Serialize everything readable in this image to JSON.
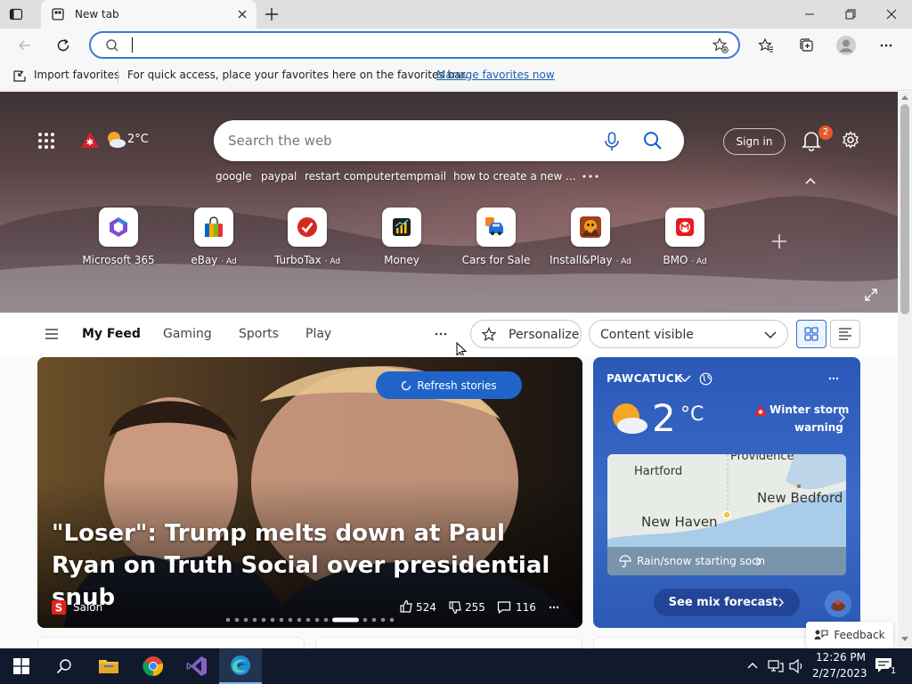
{
  "browser": {
    "tab_title": "New tab",
    "address_value": "",
    "favorites_bar": {
      "import_label": "Import favorites",
      "message": "For quick access, place your favorites here on the favorites bar.",
      "manage_link": "Manage favorites now"
    }
  },
  "hero": {
    "temperature": "2°C",
    "search_placeholder": "Search the web",
    "sign_in_label": "Sign in",
    "notification_count": "2",
    "trending": [
      "google",
      "paypal",
      "restart computer",
      "tempmail",
      "how to create a new ..."
    ],
    "quick_links": [
      {
        "label": "Microsoft 365",
        "ad": ""
      },
      {
        "label": "eBay",
        "ad": "· Ad"
      },
      {
        "label": "TurboTax",
        "ad": "· Ad"
      },
      {
        "label": "Money",
        "ad": ""
      },
      {
        "label": "Cars for Sale",
        "ad": ""
      },
      {
        "label": "Install&Play",
        "ad": "· Ad"
      },
      {
        "label": "BMO",
        "ad": "· Ad"
      }
    ]
  },
  "feed_nav": {
    "tabs": [
      "My Feed",
      "Gaming",
      "Sports",
      "Play"
    ],
    "personalize_label": "Personalize",
    "content_visible_label": "Content visible"
  },
  "story": {
    "refresh_label": "Refresh stories",
    "headline": "\"Loser\": Trump melts down at Paul Ryan on Truth Social over presidential snub",
    "source": "Salon",
    "likes": "524",
    "dislikes": "255",
    "comments": "116"
  },
  "weather": {
    "location": "PAWCATUCK",
    "temp": "2",
    "unit": "°C",
    "alert_line1": "Winter storm",
    "alert_line2": "warning",
    "map_places": [
      "Hartford",
      "Providence",
      "New Bedford",
      "New Haven"
    ],
    "precip": "Rain/snow starting soon",
    "forecast_label": "See mix forecast"
  },
  "feedback_label": "Feedback",
  "taskbar": {
    "time": "12:26 PM",
    "date": "2/27/2023",
    "notif_count": "1"
  }
}
